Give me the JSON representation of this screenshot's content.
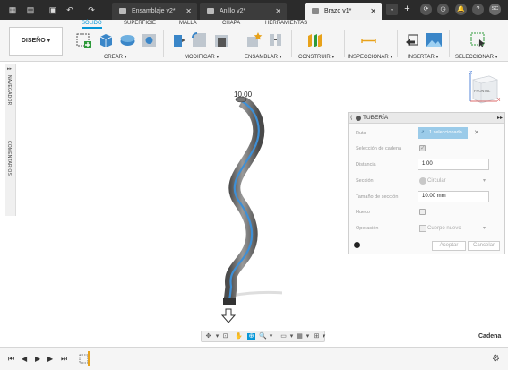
{
  "tabs": [
    {
      "label": "Ensamblaje v2*",
      "active": false
    },
    {
      "label": "Anillo v2*",
      "active": false
    },
    {
      "label": "Brazo v1*",
      "active": true
    }
  ],
  "account": {
    "initials": "SC"
  },
  "toolbar": {
    "design_label": "DISEÑO ▾",
    "workspace_tabs": [
      "SÓLIDO",
      "SUPERFICIE",
      "MALLA",
      "CHAPA",
      "HERRAMIENTAS"
    ],
    "groups": [
      "CREAR ▾",
      "MODIFICAR ▾",
      "ENSAMBLAR ▾",
      "CONSTRUIR ▾",
      "INSPECCIONAR ▾",
      "INSERTAR ▾",
      "SELECCIONAR ▾"
    ]
  },
  "side_panel": {
    "navigator": "NAVEGADOR",
    "comments": "COMENTARIOS"
  },
  "viewcube": {
    "top": "FRONTAL",
    "z": "Z",
    "x": "X"
  },
  "viewport": {
    "dimension_label": "10.00"
  },
  "dialog": {
    "title": "TUBERÍA",
    "rows": {
      "path_label": "Ruta",
      "path_value": "1 seleccionado",
      "chain_label": "Selección de cadena",
      "distance_label": "Distancia",
      "distance_value": "1.00",
      "section_label": "Sección",
      "section_value": "Circular",
      "section_size_label": "Tamaño de sección",
      "section_size_value": "10.00 mm",
      "hollow_label": "Hueco",
      "operation_label": "Operación",
      "operation_value": "Cuerpo nuevo"
    },
    "ok_label": "Aceptar",
    "cancel_label": "Cancelar"
  },
  "status": {
    "text": "Cadena"
  },
  "colors": {
    "accent": "#0696d7",
    "pipe_highlight": "#3d8fd6",
    "tabbar": "#2b2b2b"
  }
}
